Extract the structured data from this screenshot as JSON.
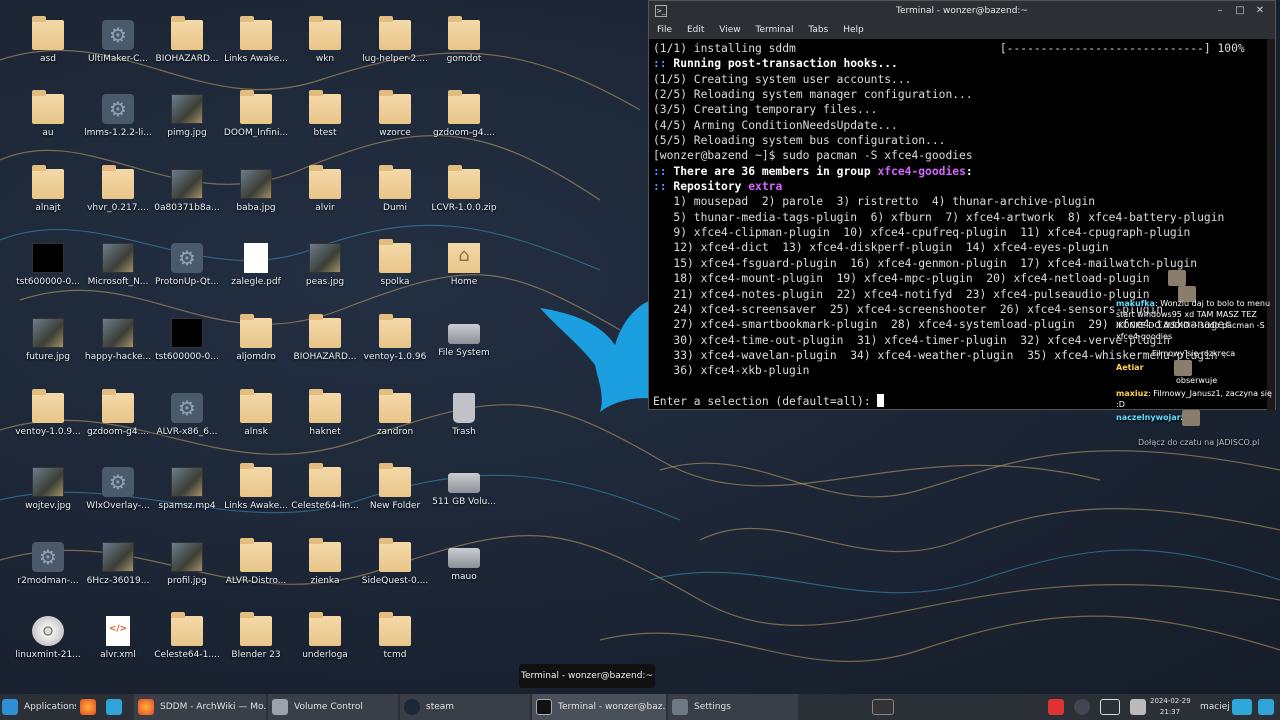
{
  "desktop": {
    "icons": [
      {
        "label": "asd",
        "type": "folder"
      },
      {
        "label": "UltiMaker-C...",
        "type": "gear"
      },
      {
        "label": "BIOHAZARD...",
        "type": "folder"
      },
      {
        "label": "Links Awake...",
        "type": "folder"
      },
      {
        "label": "wkn",
        "type": "folder"
      },
      {
        "label": "lug-helper-2....",
        "type": "folder"
      },
      {
        "label": "gomdot",
        "type": "folder"
      },
      {
        "label": "au",
        "type": "folder"
      },
      {
        "label": "lmms-1.2.2-li...",
        "type": "gear"
      },
      {
        "label": "pimg.jpg",
        "type": "image"
      },
      {
        "label": "DOOM_Infini...",
        "type": "folder"
      },
      {
        "label": "btest",
        "type": "folder"
      },
      {
        "label": "wzorce",
        "type": "folder"
      },
      {
        "label": "gzdoom-g4....",
        "type": "folder"
      },
      {
        "label": "alnajt",
        "type": "folder"
      },
      {
        "label": "vhvr_0.217....",
        "type": "folder"
      },
      {
        "label": "0a80371b8a...",
        "type": "image"
      },
      {
        "label": "baba.jpg",
        "type": "image"
      },
      {
        "label": "alvir",
        "type": "folder"
      },
      {
        "label": "Dumi",
        "type": "folder"
      },
      {
        "label": "LCVR-1.0.0.zip",
        "type": "folder"
      },
      {
        "label": "tst600000-0...",
        "type": "video"
      },
      {
        "label": "Microsoft_N...",
        "type": "image"
      },
      {
        "label": "ProtonUp-Qt...",
        "type": "gear"
      },
      {
        "label": "zalegle.pdf",
        "type": "doc"
      },
      {
        "label": "peas.jpg",
        "type": "image"
      },
      {
        "label": "spolka",
        "type": "folder"
      },
      {
        "label": "Home",
        "type": "home"
      },
      {
        "label": "future.jpg",
        "type": "image"
      },
      {
        "label": "happy-hacke...",
        "type": "image"
      },
      {
        "label": "tst600000-0...",
        "type": "video"
      },
      {
        "label": "aljomdro",
        "type": "folder"
      },
      {
        "label": "BIOHAZARD...",
        "type": "folder"
      },
      {
        "label": "ventoy-1.0.96",
        "type": "folder"
      },
      {
        "label": "File System",
        "type": "disk"
      },
      {
        "label": "ventoy-1.0.9...",
        "type": "folder"
      },
      {
        "label": "gzdoom-g4....",
        "type": "folder"
      },
      {
        "label": "ALVR-x86_6...",
        "type": "gear"
      },
      {
        "label": "alnsk",
        "type": "folder"
      },
      {
        "label": "haknet",
        "type": "folder"
      },
      {
        "label": "zandron",
        "type": "folder"
      },
      {
        "label": "Trash",
        "type": "trash"
      },
      {
        "label": "wojtev.jpg",
        "type": "image"
      },
      {
        "label": "WlxOverlay-...",
        "type": "gear"
      },
      {
        "label": "spamsz.mp4",
        "type": "image"
      },
      {
        "label": "Links Awake...",
        "type": "folder"
      },
      {
        "label": "Celeste64-lin...",
        "type": "folder"
      },
      {
        "label": "New Folder",
        "type": "folder"
      },
      {
        "label": "511 GB Volu...",
        "type": "disk"
      },
      {
        "label": "r2modman-...",
        "type": "gear"
      },
      {
        "label": "6Hcz-36019...",
        "type": "image"
      },
      {
        "label": "profil.jpg",
        "type": "image"
      },
      {
        "label": "ALVR-Distro...",
        "type": "folder"
      },
      {
        "label": "zienka",
        "type": "folder"
      },
      {
        "label": "SideQuest-0....",
        "type": "folder"
      },
      {
        "label": "mauo",
        "type": "disk"
      },
      {
        "label": "linuxmint-21...",
        "type": "cd"
      },
      {
        "label": "alvr.xml",
        "type": "xml"
      },
      {
        "label": "Celeste64-1....",
        "type": "folder"
      },
      {
        "label": "Blender 23",
        "type": "folder"
      },
      {
        "label": "underloga",
        "type": "folder"
      },
      {
        "label": "tcmd",
        "type": "folder"
      }
    ]
  },
  "terminal": {
    "title": "Terminal - wonzer@bazend:~",
    "menu": [
      "File",
      "Edit",
      "View",
      "Terminal",
      "Tabs",
      "Help"
    ],
    "lines": {
      "l1": "(1/1) installing sddm                              [-----------------------------] 100%",
      "l2_prefix": ":: ",
      "l2": "Running post-transaction hooks...",
      "l3": "(1/5) Creating system user accounts...",
      "l4": "(2/5) Reloading system manager configuration...",
      "l5": "(3/5) Creating temporary files...",
      "l6": "(4/5) Arming ConditionNeedsUpdate...",
      "l7": "(5/5) Reloading system bus configuration...",
      "l8": "[wonzer@bazend ~]$ sudo pacman -S xfce4-goodies",
      "l9_a": "There are 36 members in group ",
      "l9_b": "xfce4-goodies",
      "l9_c": ":",
      "l10_a": "Repository ",
      "l10_b": "extra",
      "members": [
        "   1) mousepad  2) parole  3) ristretto  4) thunar-archive-plugin",
        "   5) thunar-media-tags-plugin  6) xfburn  7) xfce4-artwork  8) xfce4-battery-plugin",
        "   9) xfce4-clipman-plugin  10) xfce4-cpufreq-plugin  11) xfce4-cpugraph-plugin",
        "   12) xfce4-dict  13) xfce4-diskperf-plugin  14) xfce4-eyes-plugin",
        "   15) xfce4-fsguard-plugin  16) xfce4-genmon-plugin  17) xfce4-mailwatch-plugin",
        "   18) xfce4-mount-plugin  19) xfce4-mpc-plugin  20) xfce4-netload-plugin",
        "   21) xfce4-notes-plugin  22) xfce4-notifyd  23) xfce4-pulseaudio-plugin",
        "   24) xfce4-screensaver  25) xfce4-screenshooter  26) xfce4-sensors-plugin",
        "   27) xfce4-smartbookmark-plugin  28) xfce4-systemload-plugin  29) xfce4-taskmanager",
        "   30) xfce4-time-out-plugin  31) xfce4-timer-plugin  32) xfce4-verve-plugin",
        "   33) xfce4-wavelan-plugin  34) xfce4-weather-plugin  35) xfce4-whiskermenu-plugin",
        "   36) xfce4-xkb-plugin"
      ],
      "prompt": "Enter a selection (default=all): "
    }
  },
  "chat": {
    "messages": [
      {
        "user": "makufka",
        "text": "Wonziu daj to bolo to menu start windows95 xd TAM MASZ TEZ IKONKE DO AUDIO -- sudo pacman -S xfce4-goodies"
      },
      {
        "user": "",
        "text": "Filmowy się rozkręca"
      },
      {
        "user": "Aetiar",
        "text": ""
      },
      {
        "user": "",
        "text": "obserwuje"
      },
      {
        "user": "maxiuz",
        "text": "Filmowy_Janusz1, zaczyna się :D"
      },
      {
        "user": "naczelnywojarz",
        "text": ""
      }
    ],
    "footer": "Dołącz do czatu na JADISCO.pl"
  },
  "tooltip": "Terminal - wonzer@bazend:~",
  "taskbar": {
    "apps_label": "Applications",
    "tasks": [
      {
        "label": "SDDM - ArchWiki — Mo..."
      },
      {
        "label": "Volume Control"
      },
      {
        "label": "steam"
      },
      {
        "label": "Terminal - wonzer@baz..."
      },
      {
        "label": "Settings"
      }
    ],
    "clock_date": "2024-02-29",
    "clock_time": "21:37",
    "user": "maciej"
  }
}
